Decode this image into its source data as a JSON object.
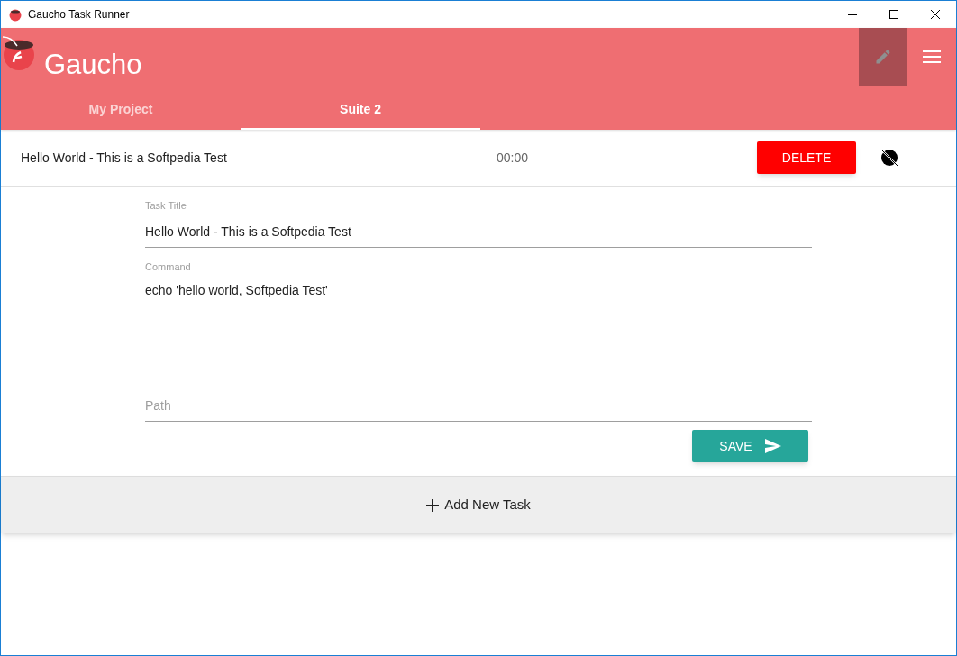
{
  "window": {
    "title": "Gaucho Task Runner"
  },
  "app_bar": {
    "title": "Gaucho",
    "edit_active": true
  },
  "tabs": [
    {
      "label": "My Project",
      "selected": false
    },
    {
      "label": "Suite 2",
      "selected": true
    }
  ],
  "task": {
    "title": "Hello World - This is a Softpedia Test",
    "time": "00:00",
    "delete_label": "DELETE"
  },
  "form": {
    "fields": [
      {
        "label": "Task Title",
        "value": "Hello World - This is a Softpedia Test",
        "kind": "single"
      },
      {
        "label": "Command",
        "value": "echo 'hello world, Softpedia Test'",
        "kind": "multi"
      },
      {
        "placeholder": "Path",
        "kind": "single"
      }
    ],
    "save_label": "SAVE"
  },
  "add_task_label": "Add New Task"
}
